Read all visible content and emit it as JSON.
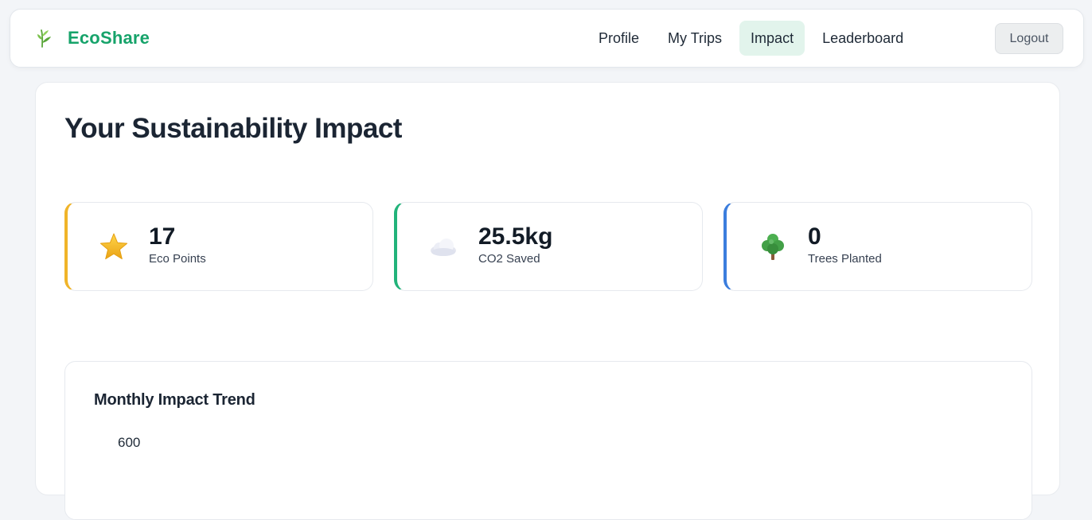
{
  "brand": {
    "name": "EcoShare",
    "icon": "leaf-sprig-icon",
    "color": "#16a36a"
  },
  "nav": {
    "items": [
      {
        "label": "Profile",
        "active": false
      },
      {
        "label": "My Trips",
        "active": false
      },
      {
        "label": "Impact",
        "active": true
      },
      {
        "label": "Leaderboard",
        "active": false
      }
    ],
    "logout_label": "Logout"
  },
  "page": {
    "title": "Your Sustainability Impact"
  },
  "stats": [
    {
      "value": "17",
      "label": "Eco Points",
      "icon": "star-icon",
      "accent": "#f0b429"
    },
    {
      "value": "25.5kg",
      "label": "CO2 Saved",
      "icon": "cloud-icon",
      "accent": "#22b37a"
    },
    {
      "value": "0",
      "label": "Trees Planted",
      "icon": "tree-icon",
      "accent": "#3b7ddd"
    }
  ],
  "chart": {
    "title": "Monthly Impact Trend",
    "y_ticks_visible": [
      "600"
    ]
  },
  "colors": {
    "active_nav_bg": "#e2f4ec",
    "page_bg": "#f3f5f8"
  }
}
